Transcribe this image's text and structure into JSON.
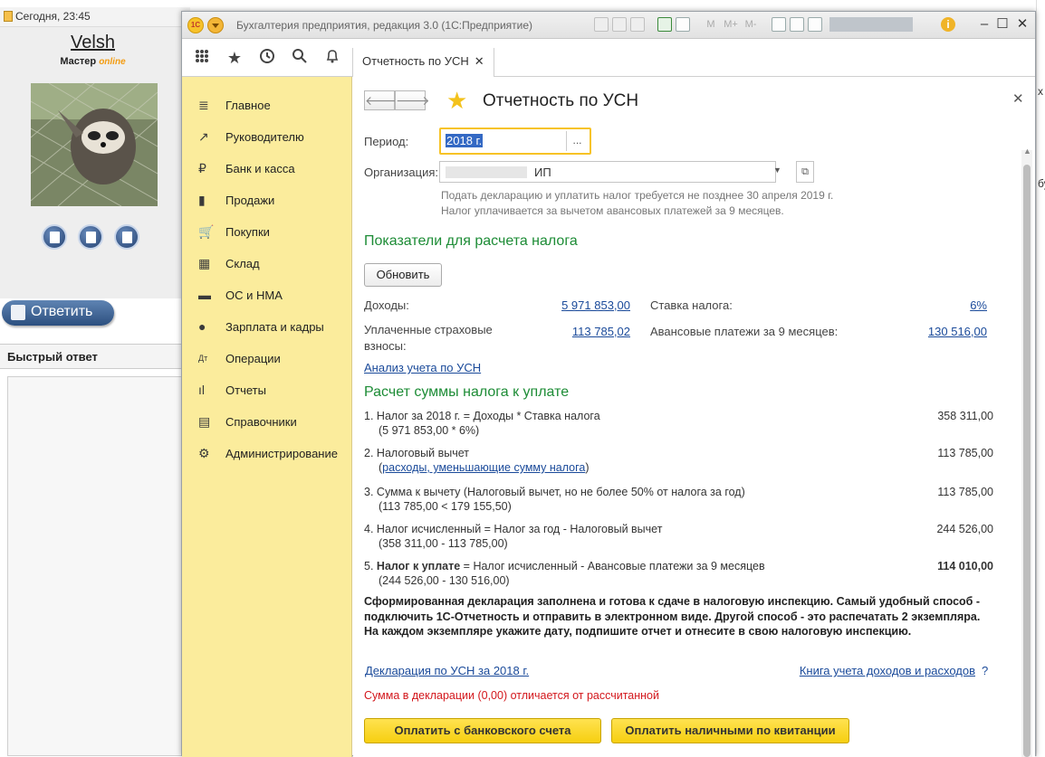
{
  "forum": {
    "date_label": "Сегодня, 23:45",
    "username": "Velsh",
    "rank": "Мастер",
    "rank_badge": "online",
    "reply_button": "Ответить",
    "quick_reply_title": "Быстрый ответ",
    "edge_fragments": [
      "х",
      "бу"
    ]
  },
  "app": {
    "title": "Бухгалтерия предприятия, редакция 3.0  (1С:Предприятие)",
    "toolbar_m": [
      "M",
      "M+",
      "M-"
    ],
    "logo": "1С",
    "window_controls": [
      "–",
      "☐",
      "✕"
    ],
    "tab": {
      "label": "Отчетность по УСН",
      "close": "✕"
    },
    "sidebar": [
      {
        "icon": "menu-icon",
        "glyph": "≣",
        "label": "Главное"
      },
      {
        "icon": "trend-icon",
        "glyph": "↗",
        "label": "Руководителю"
      },
      {
        "icon": "ruble-icon",
        "glyph": "₽",
        "label": "Банк и касса"
      },
      {
        "icon": "bag-icon",
        "glyph": "▮",
        "label": "Продажи"
      },
      {
        "icon": "cart-icon",
        "glyph": "🛒",
        "label": "Покупки"
      },
      {
        "icon": "warehouse-icon",
        "glyph": "▦",
        "label": "Склад"
      },
      {
        "icon": "truck-icon",
        "glyph": "▬",
        "label": "ОС и НМА"
      },
      {
        "icon": "person-icon",
        "glyph": "●",
        "label": "Зарплата и кадры"
      },
      {
        "icon": "dt-kt-icon",
        "glyph": "Дт",
        "label": "Операции"
      },
      {
        "icon": "bar-chart-icon",
        "glyph": "ıl",
        "label": "Отчеты"
      },
      {
        "icon": "book-icon",
        "glyph": "▤",
        "label": "Справочники"
      },
      {
        "icon": "gear-icon",
        "glyph": "⚙",
        "label": "Администрирование"
      }
    ]
  },
  "form": {
    "title": "Отчетность по УСН",
    "period_label": "Период:",
    "period_value": "2018 г.",
    "period_button": "...",
    "org_label": "Организация:",
    "org_value": "ИП",
    "hint_line1": "Подать декларацию и уплатить налог требуется не позднее 30 апреля 2019 г.",
    "hint_line2": "Налог уплачивается за вычетом авансовых платежей за 9 месяцев.",
    "section1_title": "Показатели для расчета налога",
    "refresh_button": "Обновить",
    "income_label": "Доходы:",
    "income_value": "5 971 853,00",
    "tax_rate_label": "Ставка налога:",
    "tax_rate_value": "6%",
    "insurance_label_line1": "Уплаченные страховые",
    "insurance_label_line2": "взносы:",
    "insurance_value": "113 785,02",
    "advance_label": "Авансовые платежи за 9 месяцев:",
    "advance_value": "130 516,00",
    "analysis_link": "Анализ учета по УСН",
    "section2_title": "Расчет суммы налога к уплате",
    "calc": [
      {
        "num": "1.",
        "text": "Налог за 2018 г. = Доходы * Ставка налога",
        "sub": "(5 971 853,00 * 6%)",
        "value": "358 311,00"
      },
      {
        "num": "2.",
        "text": "Налоговый вычет",
        "sub_link": "расходы, уменьшающие сумму налога",
        "value": "113 785,00"
      },
      {
        "num": "3.",
        "text": "Сумма к вычету (Налоговый вычет, но не более 50% от налога за год)",
        "sub": "(113 785,00 < 179 155,50)",
        "value": "113 785,00"
      },
      {
        "num": "4.",
        "text": "Налог исчисленный = Налог за год - Налоговый вычет",
        "sub": "(358 311,00 - 113 785,00)",
        "value": "244 526,00"
      },
      {
        "num": "5.",
        "text_bold": "Налог к уплате",
        "text": " = Налог исчисленный - Авансовые платежи за 9 месяцев",
        "sub": "(244 526,00 - 130 516,00)",
        "value": "114 010,00"
      }
    ],
    "notice": "Сформированная декларация заполнена и готова к сдаче в налоговую инспекцию. Самый удобный способ - подключить 1С-Отчетность и отправить в электронном виде. Другой способ - это распечатать 2 экземпляра. На каждом экземпляре укажите дату, подпишите отчет и отнесите в свою налоговую инспекцию.",
    "declaration_link": "Декларация по УСН за 2018 г.",
    "book_link": "Книга учета доходов и расходов",
    "help": "?",
    "warning": "Сумма в декларации (0,00) отличается от рассчитанной",
    "pay_bank_button": "Оплатить с банковского счета",
    "pay_cash_button": "Оплатить наличными по квитанции"
  },
  "colors": {
    "sidebar_bg": "#fbec9c",
    "section_title": "#1d8c36",
    "link": "#1a4a9a",
    "warning": "#d3171c",
    "button_yellow": "#f6cf10"
  }
}
